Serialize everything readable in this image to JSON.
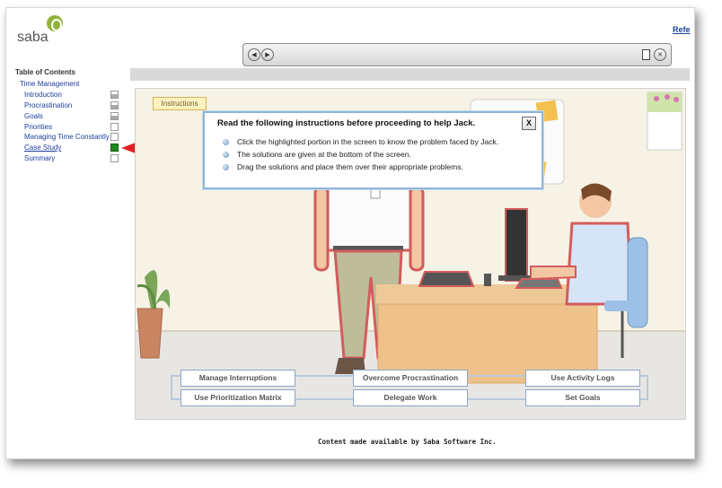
{
  "header": {
    "logo_text": "saba",
    "ref_link": "Refe"
  },
  "toolbar": {
    "prev_icon": "back-arrow-icon",
    "next_icon": "forward-arrow-icon",
    "print_icon": "clipboard-icon",
    "close_icon": "close-icon"
  },
  "toc": {
    "title": "Table of Contents",
    "root": "Time Management",
    "items": [
      {
        "label": "Introduction",
        "status": "partial"
      },
      {
        "label": "Procrastination",
        "status": "partial"
      },
      {
        "label": "Goals",
        "status": "partial"
      },
      {
        "label": "Priorities",
        "status": "empty"
      },
      {
        "label": "Managing Time Constantly",
        "status": "empty"
      },
      {
        "label": "Case Study",
        "status": "current"
      },
      {
        "label": "Summary",
        "status": "empty"
      }
    ]
  },
  "content": {
    "instructions_tab": "Instructions",
    "dialog": {
      "title": "Read the following instructions before proceeding to help Jack.",
      "close_label": "X",
      "bullets": [
        "Click the highlighted portion in the screen to know the problem faced by Jack.",
        "The solutions are given at the bottom of the screen.",
        "Drag the solutions and place them over their appropriate problems."
      ]
    },
    "solutions": [
      "Manage Interruptions",
      "Overcome Procrastination",
      "Use Activity Logs",
      "Use Prioritization Matrix",
      "Delegate Work",
      "Set Goals"
    ]
  },
  "footer": {
    "text": "Content made available by Saba Software Inc."
  },
  "colors": {
    "link": "#1c3f9c",
    "current_marker": "#1f8a1f",
    "annotation_arrow": "#e02020",
    "highlight_outline": "#d9534f"
  }
}
